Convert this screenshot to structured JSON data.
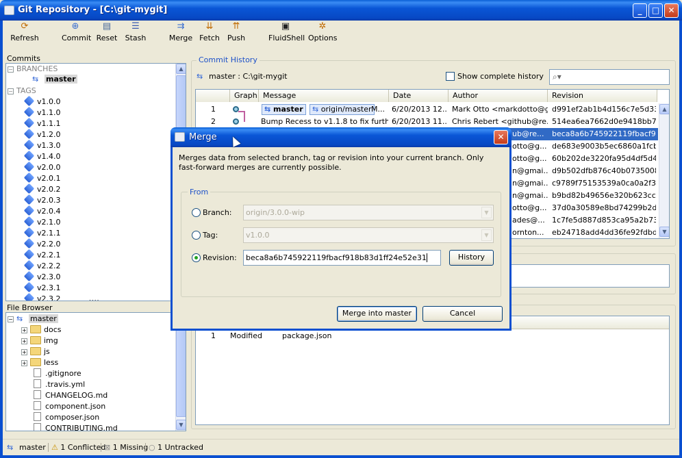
{
  "window": {
    "title": "Git Repository - [C:\\git-mygit]"
  },
  "toolbar": {
    "refresh": "Refresh",
    "commit": "Commit",
    "reset": "Reset",
    "stash": "Stash",
    "merge": "Merge",
    "fetch": "Fetch",
    "push": "Push",
    "fluidshell": "FluidShell",
    "options": "Options"
  },
  "commits_panel": {
    "title": "Commits",
    "branches_header": "BRANCHES",
    "branch": "master",
    "tags_header": "TAGS",
    "tags": [
      "v1.0.0",
      "v1.1.0",
      "v1.1.1",
      "v1.2.0",
      "v1.3.0",
      "v1.4.0",
      "v2.0.0",
      "v2.0.1",
      "v2.0.2",
      "v2.0.3",
      "v2.0.4",
      "v2.1.0",
      "v2.1.1",
      "v2.2.0",
      "v2.2.1",
      "v2.2.2",
      "v2.3.0",
      "v2.3.1",
      "v2.3.2"
    ],
    "splitter": "...."
  },
  "file_browser": {
    "title": "File Browser",
    "root": "master",
    "folders": [
      "docs",
      "img",
      "js",
      "less"
    ],
    "files": [
      ".gitignore",
      ".travis.yml",
      "CHANGELOG.md",
      "component.json",
      "composer.json",
      "CONTRIBUTING.md"
    ]
  },
  "commit_history": {
    "title": "Commit History",
    "repo": "master : C:\\git-mygit",
    "show_complete_history": "Show complete history",
    "search_placeholder": "",
    "columns": [
      "Graph",
      "Message",
      "Date",
      "Author",
      "Revision"
    ],
    "rows": [
      {
        "num": "1",
        "branch_tag": "master",
        "remote_tag": "origin/master",
        "message": "M...",
        "date": "6/20/2013 12...",
        "author": "Mark Otto <markdotto@g...",
        "revision": "d991ef2ab1b4d156c7e5d33..."
      },
      {
        "num": "2",
        "message": "Bump Recess to v1.1.8 to fix further...",
        "date": "6/20/2013 11...",
        "author": "Chris Rebert <github@re...",
        "revision": "514ea6ea7662d0e9418bb7..."
      },
      {
        "num": "",
        "author": "ub@re...",
        "revision": "beca8a6b745922119fbacf9..."
      },
      {
        "num": "",
        "author": "otto@g...",
        "revision": "de683e9003b5ec6860a1fcb..."
      },
      {
        "num": "",
        "author": "otto@g...",
        "revision": "60b202de3220fa95d4df5d4..."
      },
      {
        "num": "",
        "author": "n@gmai...",
        "revision": "d9b502dfb876c40b0735008..."
      },
      {
        "num": "",
        "author": "n@gmai...",
        "revision": "c9789f75153539a0ca0a2f3..."
      },
      {
        "num": "",
        "author": "n@gmai...",
        "revision": "b9bd82b49656e320b623cc3..."
      },
      {
        "num": "",
        "author": "otto@g...",
        "revision": "37d0a30589e8bd74299b2d..."
      },
      {
        "num": "",
        "author": "ades@...",
        "revision": "1c7fe5d887d853ca95a2b73..."
      },
      {
        "num": "",
        "author": "ornton...",
        "revision": "eb24718add4dd36fe92fdbd..."
      }
    ]
  },
  "changes": {
    "rows": [
      {
        "num": "1",
        "status": "Modified",
        "file": "package.json"
      }
    ]
  },
  "status_bar": {
    "branch": "master",
    "conflicted": "1 Conflicted",
    "missing": "1 Missing",
    "untracked": "1 Untracked"
  },
  "merge_dialog": {
    "title": "Merge",
    "description": "Merges data from selected branch, tag or revision into your current branch. Only fast-forward merges are currently possible.",
    "group_label": "From",
    "branch_label": "Branch:",
    "branch_value": "origin/3.0.0-wip",
    "tag_label": "Tag:",
    "tag_value": "v1.0.0",
    "revision_label": "Revision:",
    "revision_value": "beca8a6b745922119fbacf918b83d1ff24e52e31",
    "history_button": "History",
    "merge_button": "Merge into master",
    "cancel_button": "Cancel"
  }
}
